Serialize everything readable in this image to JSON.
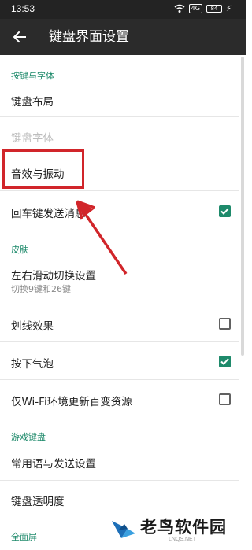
{
  "status_bar": {
    "time": "13:53",
    "network_badge": "4G",
    "battery": "84"
  },
  "app_bar": {
    "title": "键盘界面设置",
    "back_icon": "arrow-left-icon"
  },
  "sections": {
    "keys_fonts": "按键与字体",
    "skin": "皮肤",
    "game_keyboard": "游戏键盘",
    "fullscreen": "全面屏"
  },
  "items": {
    "keyboard_layout": "键盘布局",
    "keyboard_font": "键盘字体",
    "sound_vibration": "音效与振动",
    "enter_send": {
      "label": "回车键发送消息",
      "checked": true
    },
    "swipe_switch": {
      "label": "左右滑动切换设置",
      "subtitle": "切换9键和26键"
    },
    "line_effect": {
      "label": "划线效果",
      "checked": false
    },
    "key_bubble": {
      "label": "按下气泡",
      "checked": true
    },
    "wifi_update": {
      "label": "仅Wi-Fi环境更新百变资源",
      "checked": false
    },
    "common_phrases": "常用语与发送设置",
    "keyboard_transparency": "键盘透明度"
  },
  "colors": {
    "accent": "#1e8a6b",
    "annotation": "#d1252a",
    "app_bar": "#2b2b2b"
  },
  "watermark": {
    "name": "老鸟软件园",
    "url": "LNQS.NET"
  }
}
